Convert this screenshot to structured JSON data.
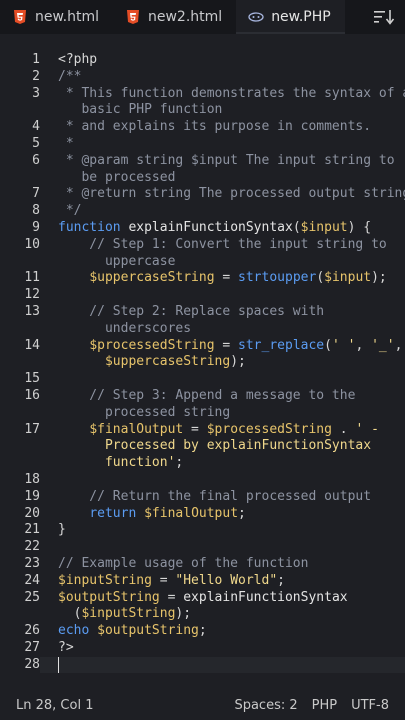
{
  "tabs": [
    {
      "label": "new.html",
      "icon": "html5-icon",
      "active": false
    },
    {
      "label": "new2.html",
      "icon": "html5-icon",
      "active": false
    },
    {
      "label": "new.PHP",
      "icon": "php-icon",
      "active": true
    }
  ],
  "toolbar": {
    "sort_icon": "sort-icon"
  },
  "colors": {
    "background": "#1e1f24",
    "keyword": "#5b9cf2",
    "variable": "#e7c46b",
    "string": "#f0d88c",
    "comment": "#8d93a1",
    "html_icon": "#e44d26"
  },
  "editor": {
    "lines": [
      {
        "n": "1",
        "segs": [
          {
            "t": "plain",
            "v": "<?php"
          }
        ]
      },
      {
        "n": "2",
        "segs": [
          {
            "t": "cm",
            "v": "/**"
          }
        ]
      },
      {
        "n": "3",
        "segs": [
          {
            "t": "cm",
            "v": " * This function demonstrates the syntax of a"
          }
        ]
      },
      {
        "n": "",
        "segs": [
          {
            "t": "cm",
            "v": "   basic PHP function"
          }
        ]
      },
      {
        "n": "4",
        "segs": [
          {
            "t": "cm",
            "v": " * and explains its purpose in comments."
          }
        ]
      },
      {
        "n": "5",
        "segs": [
          {
            "t": "cm",
            "v": " *"
          }
        ]
      },
      {
        "n": "6",
        "segs": [
          {
            "t": "cm",
            "v": " * @param string $input The input string to"
          }
        ]
      },
      {
        "n": "",
        "segs": [
          {
            "t": "cm",
            "v": "   be processed"
          }
        ]
      },
      {
        "n": "7",
        "segs": [
          {
            "t": "cm",
            "v": " * @return string The processed output string"
          }
        ]
      },
      {
        "n": "8",
        "segs": [
          {
            "t": "cm",
            "v": " */"
          }
        ]
      },
      {
        "n": "9",
        "segs": [
          {
            "t": "kw",
            "v": "function"
          },
          {
            "t": "plain",
            "v": " "
          },
          {
            "t": "fn",
            "v": "explainFunctionSyntax"
          },
          {
            "t": "plain",
            "v": "("
          },
          {
            "t": "var",
            "v": "$input"
          },
          {
            "t": "plain",
            "v": ") {"
          }
        ]
      },
      {
        "n": "10",
        "segs": [
          {
            "t": "cm",
            "v": "    // Step 1: Convert the input string to"
          }
        ]
      },
      {
        "n": "",
        "segs": [
          {
            "t": "cm",
            "v": "      uppercase"
          }
        ]
      },
      {
        "n": "11",
        "segs": [
          {
            "t": "plain",
            "v": "    "
          },
          {
            "t": "var",
            "v": "$uppercaseString"
          },
          {
            "t": "plain",
            "v": " = "
          },
          {
            "t": "kw",
            "v": "strtoupper"
          },
          {
            "t": "plain",
            "v": "("
          },
          {
            "t": "var",
            "v": "$input"
          },
          {
            "t": "plain",
            "v": ");"
          }
        ]
      },
      {
        "n": "12",
        "segs": [
          {
            "t": "plain",
            "v": ""
          }
        ]
      },
      {
        "n": "13",
        "segs": [
          {
            "t": "cm",
            "v": "    // Step 2: Replace spaces with"
          }
        ]
      },
      {
        "n": "",
        "segs": [
          {
            "t": "cm",
            "v": "      underscores"
          }
        ]
      },
      {
        "n": "14",
        "segs": [
          {
            "t": "plain",
            "v": "    "
          },
          {
            "t": "var",
            "v": "$processedString"
          },
          {
            "t": "plain",
            "v": " = "
          },
          {
            "t": "kw",
            "v": "str_replace"
          },
          {
            "t": "plain",
            "v": "("
          },
          {
            "t": "str",
            "v": "' '"
          },
          {
            "t": "plain",
            "v": ", "
          },
          {
            "t": "str",
            "v": "'_'"
          },
          {
            "t": "plain",
            "v": ","
          }
        ]
      },
      {
        "n": "",
        "segs": [
          {
            "t": "plain",
            "v": "      "
          },
          {
            "t": "var",
            "v": "$uppercaseString"
          },
          {
            "t": "plain",
            "v": ");"
          }
        ]
      },
      {
        "n": "15",
        "segs": [
          {
            "t": "plain",
            "v": ""
          }
        ]
      },
      {
        "n": "16",
        "segs": [
          {
            "t": "cm",
            "v": "    // Step 3: Append a message to the"
          }
        ]
      },
      {
        "n": "",
        "segs": [
          {
            "t": "cm",
            "v": "      processed string"
          }
        ]
      },
      {
        "n": "17",
        "segs": [
          {
            "t": "plain",
            "v": "    "
          },
          {
            "t": "var",
            "v": "$finalOutput"
          },
          {
            "t": "plain",
            "v": " = "
          },
          {
            "t": "var",
            "v": "$processedString"
          },
          {
            "t": "plain",
            "v": " . "
          },
          {
            "t": "str",
            "v": "' -"
          }
        ]
      },
      {
        "n": "",
        "segs": [
          {
            "t": "str",
            "v": "      Processed by explainFunctionSyntax"
          }
        ]
      },
      {
        "n": "",
        "segs": [
          {
            "t": "str",
            "v": "      function'"
          },
          {
            "t": "plain",
            "v": ";"
          }
        ]
      },
      {
        "n": "18",
        "segs": [
          {
            "t": "plain",
            "v": ""
          }
        ]
      },
      {
        "n": "19",
        "segs": [
          {
            "t": "cm",
            "v": "    // Return the final processed output"
          }
        ]
      },
      {
        "n": "20",
        "segs": [
          {
            "t": "plain",
            "v": "    "
          },
          {
            "t": "kw",
            "v": "return"
          },
          {
            "t": "plain",
            "v": " "
          },
          {
            "t": "var",
            "v": "$finalOutput"
          },
          {
            "t": "plain",
            "v": ";"
          }
        ]
      },
      {
        "n": "21",
        "segs": [
          {
            "t": "plain",
            "v": "}"
          }
        ]
      },
      {
        "n": "22",
        "segs": [
          {
            "t": "plain",
            "v": ""
          }
        ]
      },
      {
        "n": "23",
        "segs": [
          {
            "t": "cm",
            "v": "// Example usage of the function"
          }
        ]
      },
      {
        "n": "24",
        "segs": [
          {
            "t": "var",
            "v": "$inputString"
          },
          {
            "t": "plain",
            "v": " = "
          },
          {
            "t": "str",
            "v": "\"Hello World\""
          },
          {
            "t": "plain",
            "v": ";"
          }
        ]
      },
      {
        "n": "25",
        "segs": [
          {
            "t": "var",
            "v": "$outputString"
          },
          {
            "t": "plain",
            "v": " = "
          },
          {
            "t": "fn",
            "v": "explainFunctionSyntax"
          }
        ]
      },
      {
        "n": "",
        "segs": [
          {
            "t": "plain",
            "v": "  ("
          },
          {
            "t": "var",
            "v": "$inputString"
          },
          {
            "t": "plain",
            "v": ");"
          }
        ]
      },
      {
        "n": "26",
        "segs": [
          {
            "t": "kw",
            "v": "echo"
          },
          {
            "t": "plain",
            "v": " "
          },
          {
            "t": "var",
            "v": "$outputString"
          },
          {
            "t": "plain",
            "v": ";"
          }
        ]
      },
      {
        "n": "27",
        "segs": [
          {
            "t": "plain",
            "v": "?>"
          }
        ]
      },
      {
        "n": "28",
        "segs": [
          {
            "t": "plain",
            "v": ""
          }
        ],
        "current": true
      }
    ]
  },
  "status": {
    "position": "Ln 28, Col 1",
    "spaces": "Spaces: 2",
    "language": "PHP",
    "encoding": "UTF-8"
  }
}
